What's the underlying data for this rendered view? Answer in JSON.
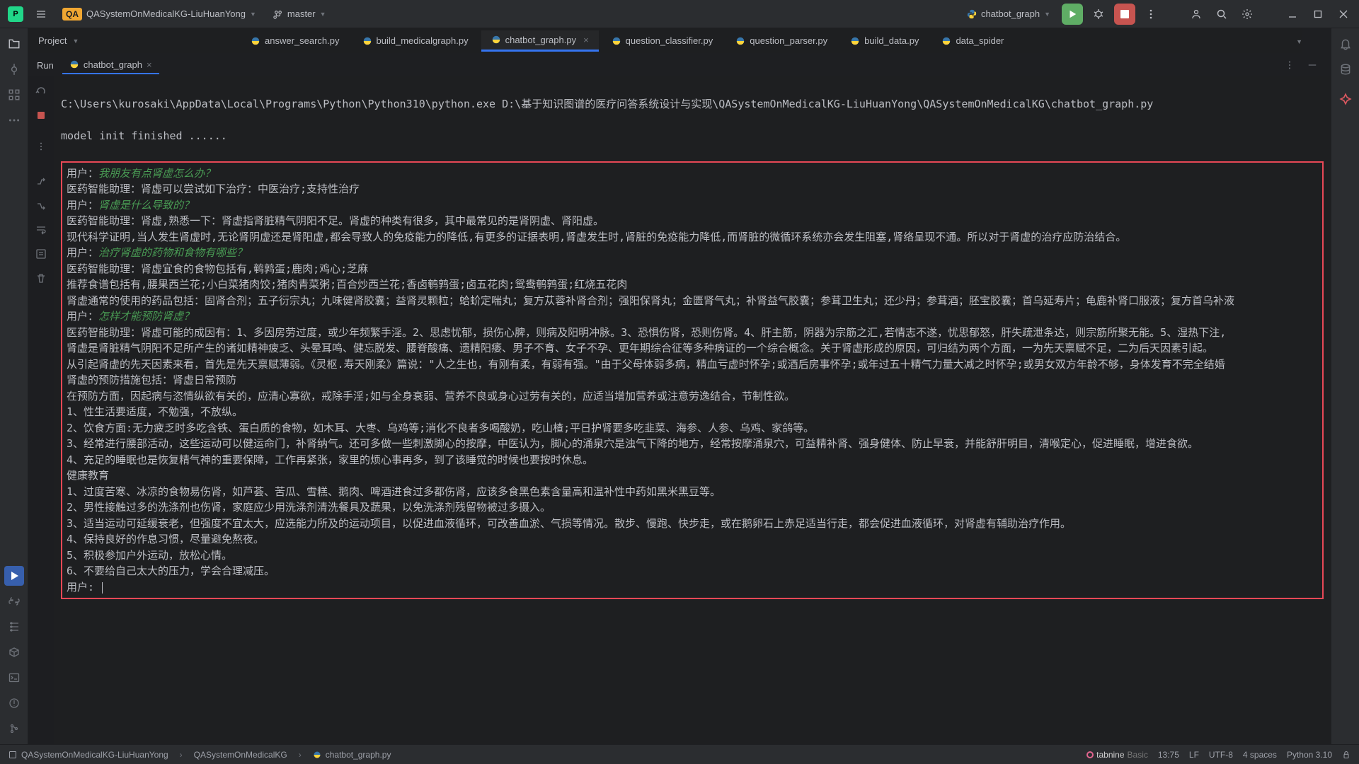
{
  "titlebar": {
    "project_name": "QASystemOnMedicalKG-LiuHuanYong",
    "branch": "master",
    "run_config": "chatbot_graph",
    "qa_badge": "QA"
  },
  "project_bar": {
    "label": "Project"
  },
  "tabs": [
    {
      "name": "answer_search.py",
      "active": false
    },
    {
      "name": "build_medicalgraph.py",
      "active": false
    },
    {
      "name": "chatbot_graph.py",
      "active": true
    },
    {
      "name": "question_classifier.py",
      "active": false
    },
    {
      "name": "question_parser.py",
      "active": false
    },
    {
      "name": "build_data.py",
      "active": false
    },
    {
      "name": "data_spider"
    }
  ],
  "run_panel": {
    "label": "Run",
    "tab_label": "chatbot_graph"
  },
  "console": {
    "cmdline": "C:\\Users\\kurosaki\\AppData\\Local\\Programs\\Python\\Python310\\python.exe D:\\基于知识图谱的医疗问答系统设计与实现\\QASystemOnMedicalKG-LiuHuanYong\\QASystemOnMedicalKG\\chatbot_graph.py",
    "init_line": "model init finished ......",
    "dialogue": [
      {
        "speaker": "用户：",
        "user_text": "我朋友有点肾虚怎么办？"
      },
      {
        "plain": "医药智能助理：肾虚可以尝试如下治疗：中医治疗;支持性治疗"
      },
      {
        "speaker": "用户：",
        "user_text": "肾虚是什么导致的？"
      },
      {
        "plain": "医药智能助理：肾虚,熟悉一下：肾虚指肾脏精气阴阳不足。肾虚的种类有很多，其中最常见的是肾阴虚、肾阳虚。"
      },
      {
        "plain": "现代科学证明,当人发生肾虚时,无论肾阴虚还是肾阳虚,都会导致人的免疫能力的降低,有更多的证据表明,肾虚发生时,肾脏的免疫能力降低,而肾脏的微循环系统亦会发生阻塞,肾络呈现不通。所以对于肾虚的治疗应防治结合。"
      },
      {
        "speaker": "用户：",
        "user_text": "治疗肾虚的药物和食物有哪些？"
      },
      {
        "plain": "医药智能助理：肾虚宜食的食物包括有,鹌鹑蛋;鹿肉;鸡心;芝麻"
      },
      {
        "plain": "推荐食谱包括有,腰果西兰花;小白菜猪肉饺;猪肉青菜粥;百合炒西兰花;香卤鹌鹑蛋;卤五花肉;鸳鸯鹌鹑蛋;红烧五花肉"
      },
      {
        "plain": "肾虚通常的使用的药品包括：固肾合剂；五子衍宗丸；九味健肾胶囊；益肾灵颗粒；蛤蚧定喘丸；复方苁蓉补肾合剂；强阳保肾丸；金匮肾气丸；补肾益气胶囊；参茸卫生丸；还少丹；参茸酒；胚宝胶囊；首乌延寿片；龟鹿补肾口服液；复方首乌补液"
      },
      {
        "speaker": "用户：",
        "user_text": "怎样才能预防肾虚？"
      },
      {
        "plain": "医药智能助理：肾虚可能的成因有：1、多因房劳过度，或少年频繁手淫。2、思虑忧郁，损伤心脾，则病及阳明冲脉。3、恐惧伤肾，恐则伤肾。4、肝主筋，阴器为宗筋之汇,若情志不遂，忧思郁怒，肝失疏泄条达，则宗筋所聚无能。5、湿热下注,"
      },
      {
        "plain": "肾虚是肾脏精气阴阳不足所产生的诸如精神疲乏、头晕耳鸣、健忘脱发、腰脊酸痛、遗精阳痿、男子不育、女子不孕、更年期综合征等多种病证的一个综合概念。关于肾虚形成的原因，可归结为两个方面，一为先天禀赋不足，二为后天因素引起。"
      },
      {
        "plain": "从引起肾虚的先天因素来看，首先是先天禀赋薄弱。《灵枢.寿天刚柔》篇说：\"人之生也，有刚有柔，有弱有强。\"由于父母体弱多病，精血亏虚时怀孕;或酒后房事怀孕;或年过五十精气力量大减之时怀孕;或男女双方年龄不够，身体发育不完全结婚"
      },
      {
        "plain": "肾虚的预防措施包括：肾虚日常预防"
      },
      {
        "plain": "在预防方面，因起病与恣情纵欲有关的，应清心寡欲，戒除手淫;如与全身衰弱、营养不良或身心过劳有关的，应适当增加营养或注意劳逸结合，节制性欲。"
      },
      {
        "plain": "1、性生活要适度，不勉强，不放纵。"
      },
      {
        "plain": "2、饮食方面:无力疲乏时多吃含铁、蛋白质的食物，如木耳、大枣、乌鸡等;消化不良者多喝酸奶，吃山楂;平日护肾要多吃韭菜、海参、人参、乌鸡、家鸽等。"
      },
      {
        "plain": "3、经常进行腰部活动，这些运动可以健运命门，补肾纳气。还可多做一些刺激脚心的按摩，中医认为，脚心的涌泉穴是浊气下降的地方，经常按摩涌泉穴，可益精补肾、强身健体、防止早衰，并能舒肝明目，清喉定心，促进睡眠，增进食欲。"
      },
      {
        "plain": "4、充足的睡眠也是恢复精气神的重要保障，工作再紧张，家里的烦心事再多，到了该睡觉的时候也要按时休息。"
      },
      {
        "plain": "健康教育"
      },
      {
        "plain": "1、过度苦寒、冰凉的食物易伤肾，如芦荟、苦瓜、雪糕、鹅肉、啤酒进食过多都伤肾，应该多食黑色素含量高和温补性中药如黑米黑豆等。"
      },
      {
        "plain": "2、男性接触过多的洗涤剂也伤肾，家庭应少用洗涤剂清洗餐具及蔬果，以免洗涤剂残留物被过多摄入。"
      },
      {
        "plain": "3、适当运动可延缓衰老，但强度不宜太大，应选能力所及的运动项目，以促进血液循环，可改善血淤、气损等情况。散步、慢跑、快步走，或在鹅卵石上赤足适当行走，都会促进血液循环，对肾虚有辅助治疗作用。"
      },
      {
        "plain": "4、保持良好的作息习惯，尽量避免熬夜。"
      },
      {
        "plain": "5、积极参加户外运动，放松心情。"
      },
      {
        "plain": "6、不要给自己太大的压力，学会合理减压。"
      },
      {
        "prompt": "用户: "
      }
    ]
  },
  "statusbar": {
    "breadcrumb": [
      "QASystemOnMedicalKG-LiuHuanYong",
      "QASystemOnMedicalKG",
      "chatbot_graph.py"
    ],
    "tabnine": "tabnine",
    "tabnine_tier": "Basic",
    "pos": "13:75",
    "line_sep": "LF",
    "encoding": "UTF-8",
    "indent": "4 spaces",
    "python": "Python 3.10"
  }
}
